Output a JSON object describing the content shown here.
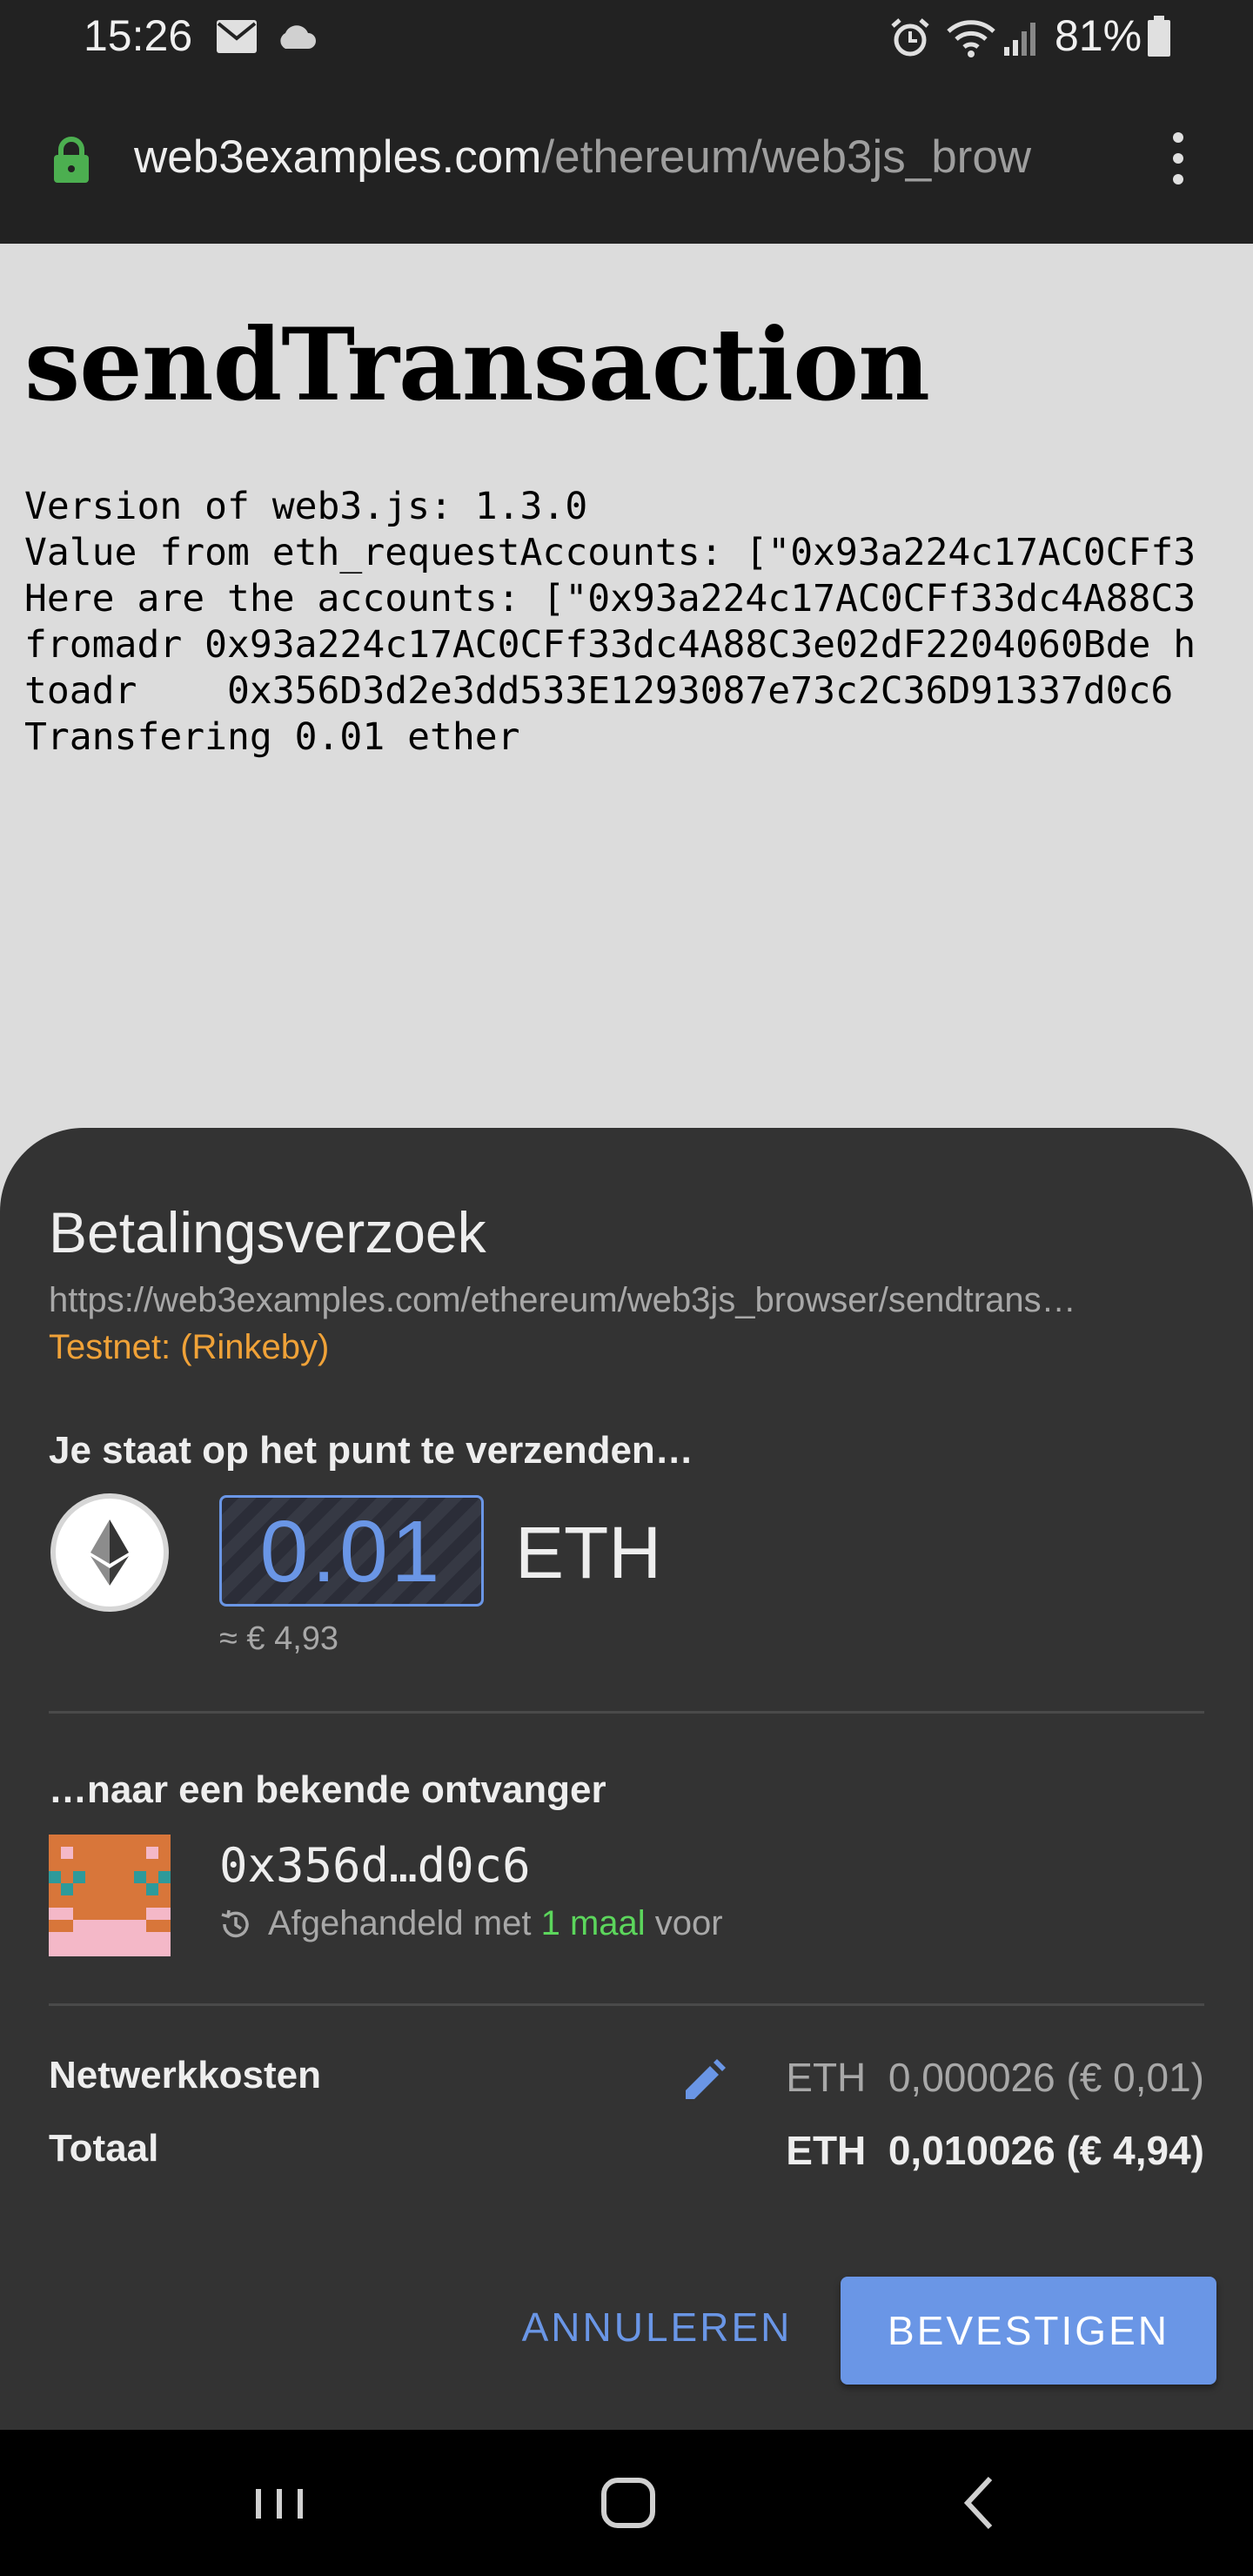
{
  "status_bar": {
    "time": "15:26",
    "battery": "81%",
    "icons": [
      "mail-icon",
      "cloud-icon",
      "alarm-icon",
      "wifi-icon",
      "signal-icon",
      "battery-icon"
    ]
  },
  "url_bar": {
    "host": "web3examples.com",
    "path": "/ethereum/web3js_brow"
  },
  "page": {
    "title": "sendTransaction",
    "log_lines": [
      "Version of web3.js: 1.3.0",
      "Value from eth_requestAccounts: [\"0x93a224c17AC0CFf3",
      "Here are the accounts: [\"0x93a224c17AC0CFf33dc4A88C3",
      "fromadr 0x93a224c17AC0CFf33dc4A88C3e02dF2204060Bde h",
      "toadr    0x356D3d2e3dd533E1293087e73c2C36D91337d0c6",
      "Transfering 0.01 ether"
    ]
  },
  "sheet": {
    "title": "Betalingsverzoek",
    "origin": "https://web3examples.com/ethereum/web3js_browser/sendtrans…",
    "network": "Testnet: (Rinkeby)",
    "send_heading": "Je staat op het punt te verzenden…",
    "amount": "0.01",
    "amount_unit": "ETH",
    "fiat_approx": "≈ € 4,93",
    "recipient_heading": "…naar een bekende ontvanger",
    "recipient_address": "0x356d…d0c6",
    "history_prefix": "Afgehandeld met",
    "history_count": "1 maal",
    "history_suffix": "voor",
    "fee_label": "Netwerkkosten",
    "fee_value": "ETH  0,000026 (€ 0,01)",
    "total_label": "Totaal",
    "total_value": "ETH  0,010026 (€ 4,94)",
    "cancel_label": "ANNULEREN",
    "confirm_label": "BEVESTIGEN"
  },
  "colors": {
    "accent": "#6a96e6",
    "network": "#f0a238",
    "history_count": "#5cd65c",
    "lock": "#4caf50"
  }
}
